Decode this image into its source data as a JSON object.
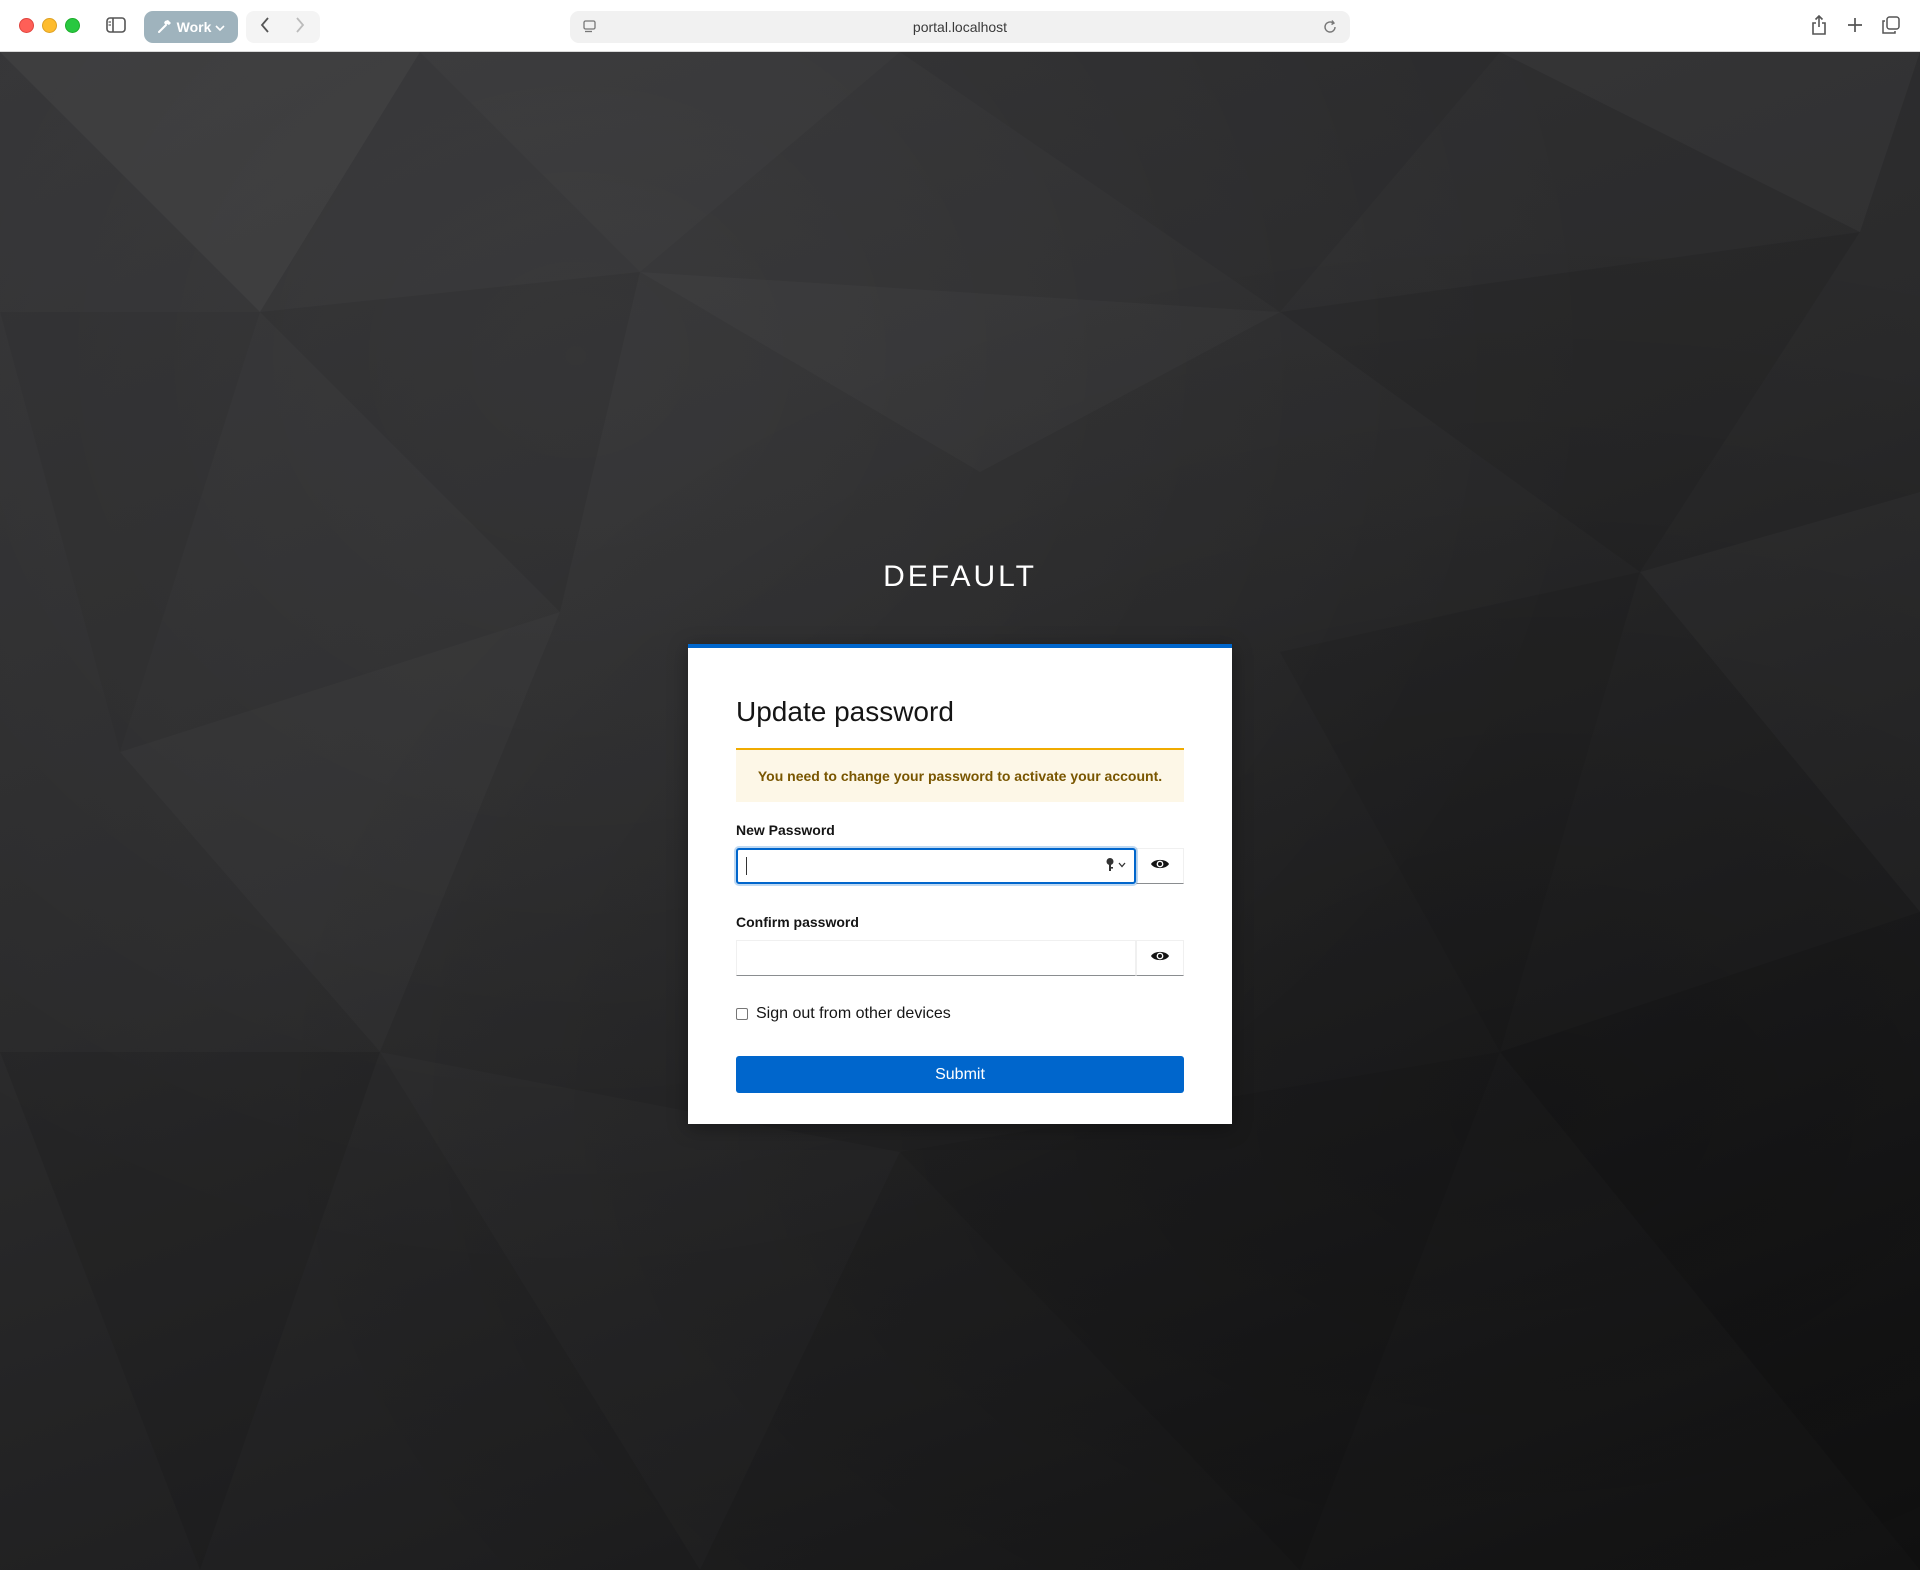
{
  "browser": {
    "profile_label": "Work",
    "url": "portal.localhost"
  },
  "page": {
    "realm_name": "DEFAULT",
    "title": "Update password",
    "alert_message": "You need to change your password to activate your account.",
    "new_password": {
      "label": "New Password",
      "value": ""
    },
    "confirm_password": {
      "label": "Confirm password",
      "value": ""
    },
    "logout_sessions": {
      "label": "Sign out from other devices",
      "checked": false
    },
    "submit_label": "Submit"
  },
  "colors": {
    "primary": "#0066cc",
    "warning_border": "#f0ab00",
    "warning_bg": "#fdf7e7",
    "warning_text": "#795600"
  }
}
